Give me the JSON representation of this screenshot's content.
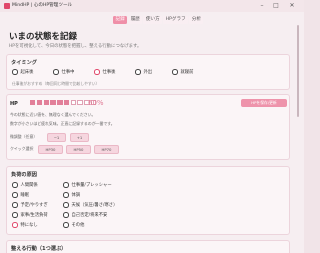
{
  "app": {
    "title": "MindHP | 心のHP管理ツール"
  },
  "tabs": [
    "記録",
    "履歴",
    "使い方",
    "HPグラフ",
    "分析"
  ],
  "page": {
    "heading": "いまの状態を記録",
    "subheading": "HPを可視化して、今日の状態を把握し、整える行動につなげます。"
  },
  "timing": {
    "title": "タイミング",
    "options": [
      "起床後",
      "仕事中",
      "仕事後",
      "外出",
      "就寝前"
    ],
    "selected": 2,
    "note": "仕事後がおすすめ（毎回同じ時間で比較しやすい）"
  },
  "mp": {
    "label": "HP",
    "filled": 6,
    "total": 10,
    "percent_label": "60%",
    "button": "HPを保存/更新",
    "hint1": "今の状態に近い値を、無理なく選んでください。",
    "hint2": "数字が小さいほど疲れ気味。正直に記録するのが一番です。",
    "adjust_label": "微調整（任意）",
    "minus": "−1",
    "plus": "+1",
    "quick_label": "クイック選択",
    "quick": [
      "HP30",
      "HP50",
      "HP70"
    ]
  },
  "load": {
    "title": "負荷の原因",
    "items": [
      "人間関係",
      "仕事量/プレッシャー",
      "睡眠",
      "体調",
      "予定/やりすぎ",
      "天候（気圧/暑さ/寒さ）",
      "家事/生活負荷",
      "自己否定/将来不安",
      "特になし",
      "その他"
    ],
    "selected": 8
  },
  "recover": {
    "title": "整える行動（1つ選ぶ）"
  },
  "colors": {
    "accent": "#e0476a",
    "pink_button": "#ee93ab",
    "filled_square": "#e27f99"
  }
}
